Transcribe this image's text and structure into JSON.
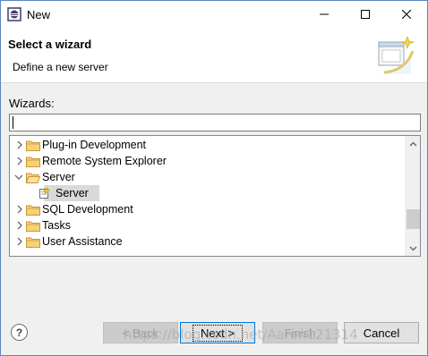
{
  "window": {
    "title": "New"
  },
  "header": {
    "title": "Select a wizard",
    "description": "Define a new server"
  },
  "filter": {
    "label": "Wizards:",
    "value": ""
  },
  "tree": {
    "items": [
      {
        "label": "Plug-in Development",
        "expanded": false,
        "level": 0,
        "icon": "folder-icon"
      },
      {
        "label": "Remote System Explorer",
        "expanded": false,
        "level": 0,
        "icon": "folder-icon"
      },
      {
        "label": "Server",
        "expanded": true,
        "level": 0,
        "icon": "folder-icon"
      },
      {
        "label": "Server",
        "expanded": null,
        "level": 1,
        "icon": "server-wizard-icon",
        "selected": true
      },
      {
        "label": "SQL Development",
        "expanded": false,
        "level": 0,
        "icon": "folder-icon"
      },
      {
        "label": "Tasks",
        "expanded": false,
        "level": 0,
        "icon": "folder-icon"
      },
      {
        "label": "User Assistance",
        "expanded": false,
        "level": 0,
        "icon": "folder-icon"
      }
    ]
  },
  "buttons": {
    "back": "< Back",
    "next": "Next >",
    "finish": "Finish",
    "cancel": "Cancel"
  },
  "help": {
    "symbol": "?"
  },
  "watermark": "https://blog.csdn.net/Aaron121314",
  "colors": {
    "accent": "#0078d7",
    "folder": "#e8b84a",
    "window_border": "#5a86c2"
  }
}
